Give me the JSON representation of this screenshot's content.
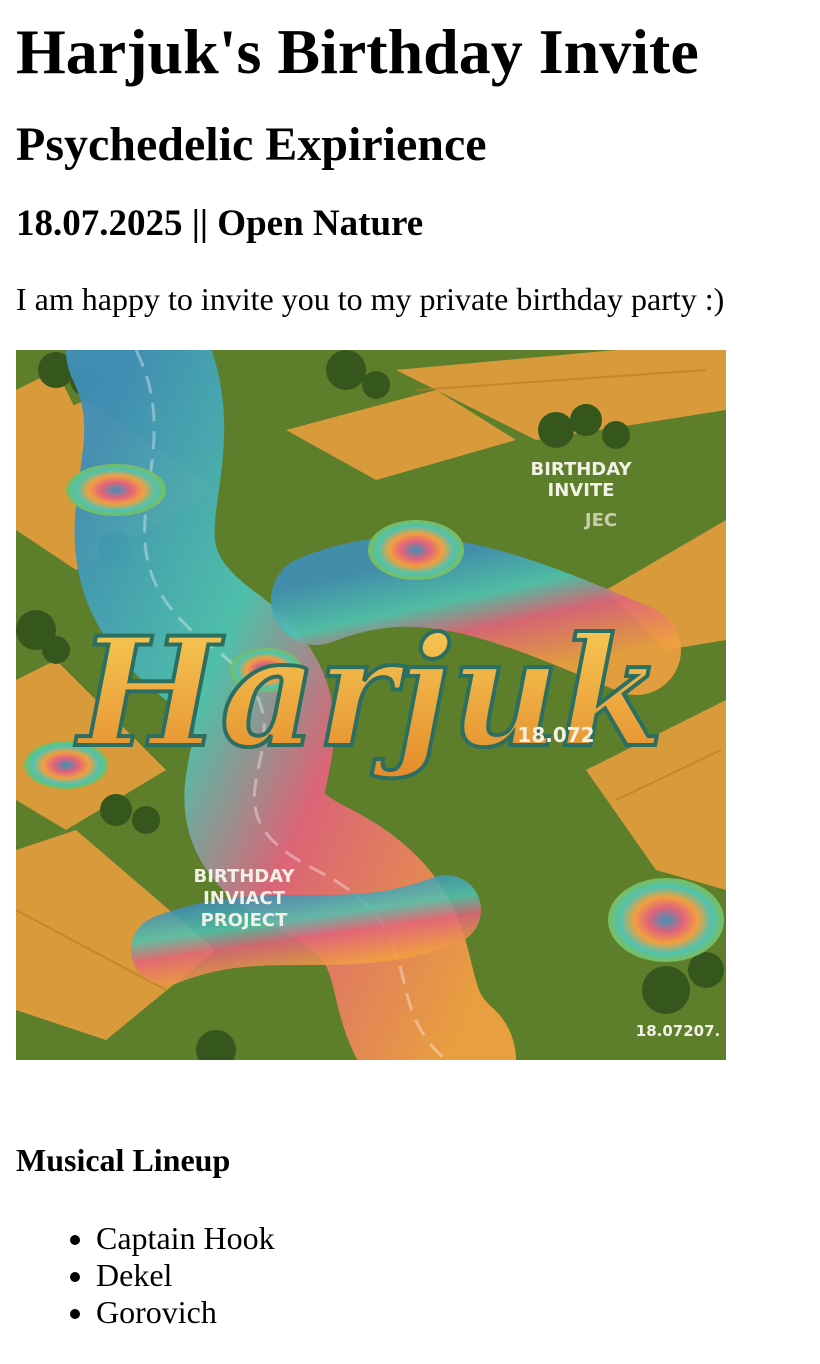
{
  "header": {
    "title": "Harjuk's Birthday Invite",
    "subtitle": "Psychedelic Expirience",
    "date_location": "18.07.2025 || Open Nature"
  },
  "intro": "I am happy to invite you to my private birthday party :)",
  "poster": {
    "main_text": "Harjuk",
    "label_top_line1": "BIRTHDAY",
    "label_top_line2": "INVITE",
    "label_top_line3": "JEC",
    "label_mid_date": "18.072",
    "label_bottom_line1": "BIRTHDAY",
    "label_bottom_line2": "INVIACT",
    "label_bottom_line3": "PROJECT",
    "label_corner_date": "18.07207.",
    "colors": {
      "field": "#d89a3a",
      "grass": "#5d7f2c",
      "river_blue": "#3f8fb8",
      "river_teal": "#4ec3b0",
      "swirl_pink": "#e2637a",
      "swirl_orange": "#f0a040",
      "letter_fill": "#f3b43f"
    }
  },
  "lineup": {
    "heading": "Musical Lineup",
    "artists": [
      "Captain Hook",
      "Dekel",
      "Gorovich"
    ]
  }
}
